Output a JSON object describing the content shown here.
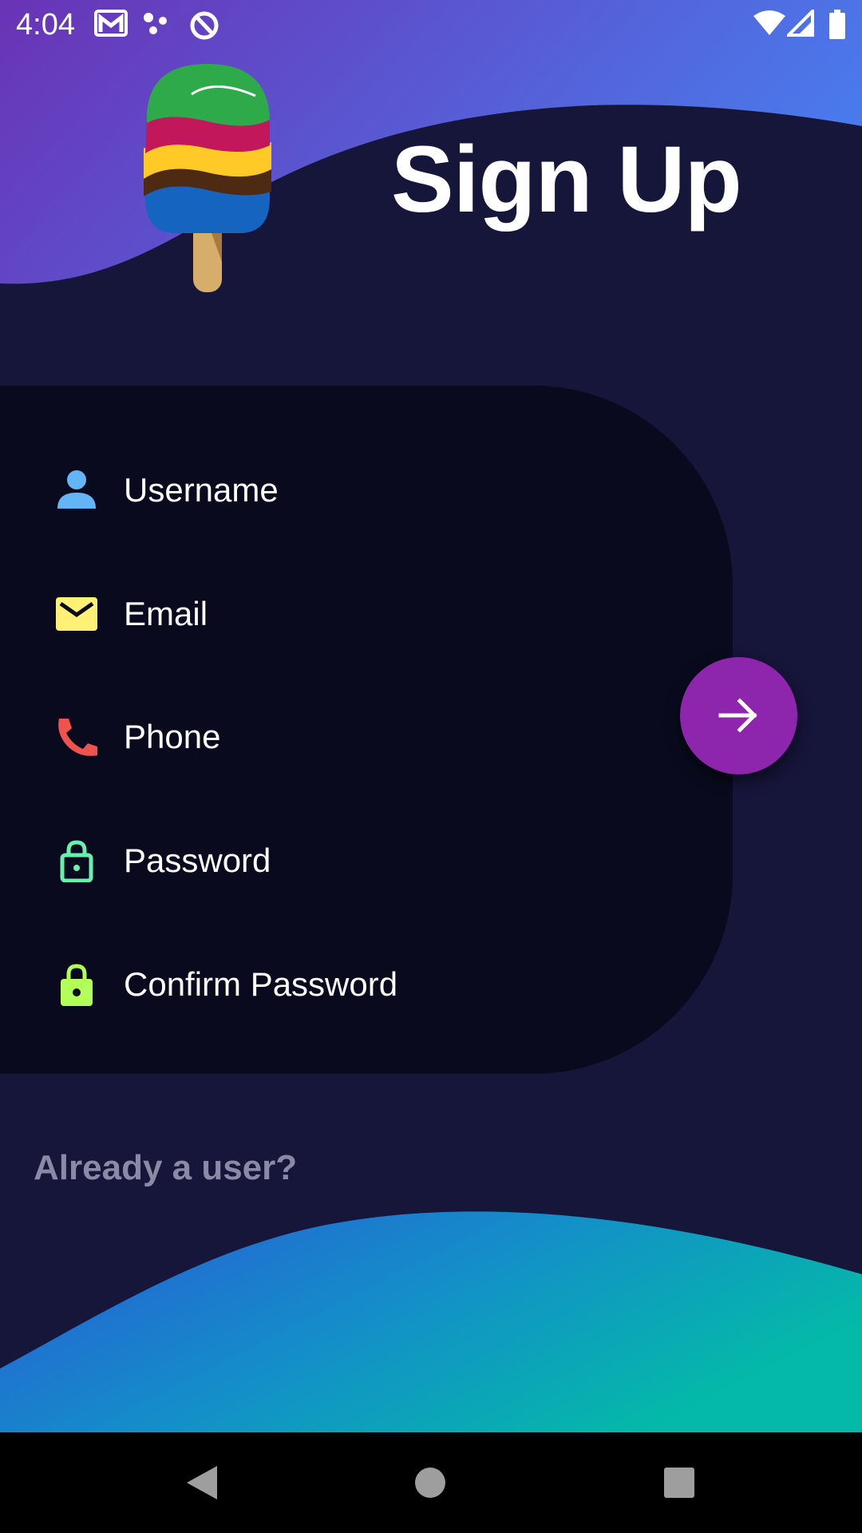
{
  "status_bar": {
    "time": "4:04",
    "left_icons": [
      "gmail-icon",
      "dots-icon",
      "data-saver-icon"
    ],
    "right_icons": [
      "wifi-icon",
      "cellular-signal-icon",
      "battery-icon"
    ]
  },
  "header": {
    "title": "Sign Up",
    "logo": "popsicle-logo"
  },
  "form": {
    "fields": [
      {
        "label": "Username",
        "icon": "person-icon",
        "icon_color": "#64b5f6"
      },
      {
        "label": "Email",
        "icon": "email-icon",
        "icon_color": "#fff176"
      },
      {
        "label": "Phone",
        "icon": "phone-icon",
        "icon_color": "#ef5350"
      },
      {
        "label": "Password",
        "icon": "lock-open-icon",
        "icon_color": "#69f0ae"
      },
      {
        "label": "Confirm Password",
        "icon": "lock-icon",
        "icon_color": "#b2ff59"
      }
    ],
    "next_button_icon": "arrow-right-icon",
    "next_button_color": "#8d25ad"
  },
  "footer": {
    "already_user": "Already a user?"
  },
  "colors": {
    "background": "#16153a",
    "card": "#090a1d",
    "top_wave_start": "#6a35b8",
    "top_wave_end": "#4a78ea",
    "bottom_wave_start": "#2a5fd8",
    "bottom_wave_end": "#05b8a8"
  },
  "nav_bar": {
    "icons": [
      "back-icon",
      "home-icon",
      "recents-icon"
    ]
  }
}
